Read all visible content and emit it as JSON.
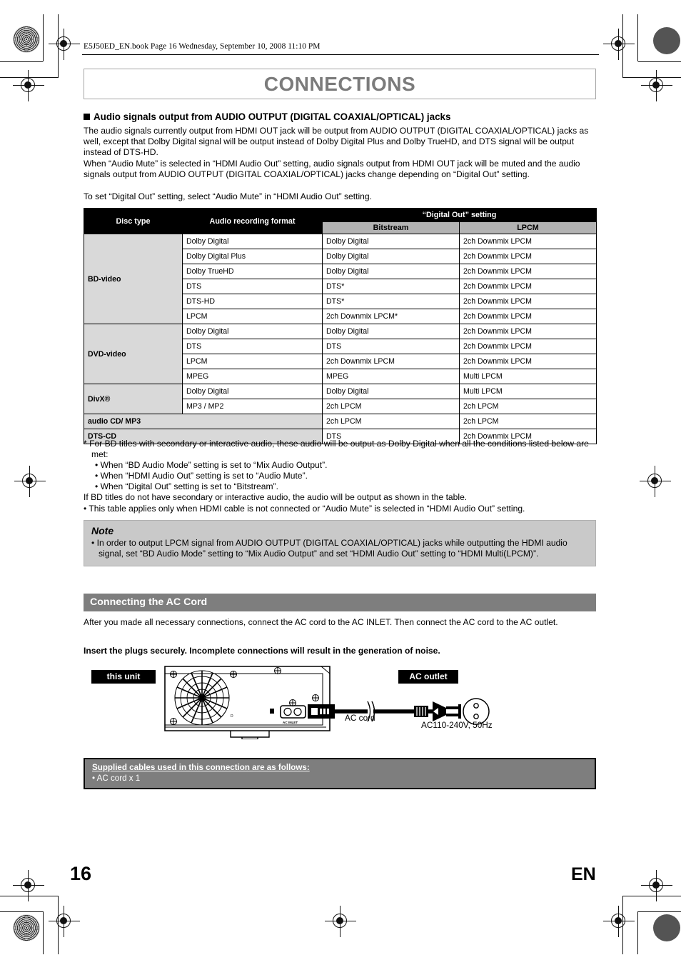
{
  "header": {
    "file_line": "E5J50ED_EN.book  Page 16  Wednesday, September 10, 2008  11:10 PM",
    "chapter_title": "CONNECTIONS"
  },
  "section": {
    "heading": "Audio signals output from AUDIO OUTPUT (DIGITAL COAXIAL/OPTICAL) jacks",
    "paragraph_1": "The audio signals currently output from HDMI OUT jack will be output from AUDIO OUTPUT (DIGITAL COAXIAL/OPTICAL) jacks as well, except that Dolby Digital signal will be output instead of Dolby Digital Plus and Dolby TrueHD, and DTS signal will be output instead of DTS-HD.",
    "paragraph_2": "When “Audio Mute” is selected in “HDMI Audio Out” setting, audio signals output from HDMI OUT jack will be muted and the audio signals output from AUDIO OUTPUT (DIGITAL COAXIAL/OPTICAL) jacks change depending on “Digital Out” setting.",
    "paragraph_3": "To set “Digital Out” setting, select “Audio Mute” in “HDMI Audio Out” setting."
  },
  "table": {
    "headers": {
      "disc_type": "Disc type",
      "audio_recording_format": "Audio recording format",
      "digital_out_setting": "“Digital Out” setting",
      "bitstream": "Bitstream",
      "lpcm": "LPCM"
    },
    "rows": [
      {
        "disc": "BD-video",
        "rowspan": 6,
        "format": "Dolby Digital",
        "bitstream": "Dolby Digital",
        "lpcm": "2ch Downmix LPCM"
      },
      {
        "format": "Dolby Digital Plus",
        "bitstream": "Dolby Digital",
        "lpcm": "2ch Downmix LPCM"
      },
      {
        "format": "Dolby TrueHD",
        "bitstream": "Dolby Digital",
        "lpcm": "2ch Downmix LPCM"
      },
      {
        "format": "DTS",
        "bitstream": "DTS*",
        "lpcm": "2ch Downmix LPCM"
      },
      {
        "format": "DTS-HD",
        "bitstream": "DTS*",
        "lpcm": "2ch Downmix LPCM"
      },
      {
        "format": "LPCM",
        "bitstream": "2ch Downmix LPCM*",
        "lpcm": "2ch Downmix LPCM"
      },
      {
        "disc": "DVD-video",
        "rowspan": 4,
        "format": "Dolby Digital",
        "bitstream": "Dolby Digital",
        "lpcm": "2ch Downmix LPCM"
      },
      {
        "format": "DTS",
        "bitstream": "DTS",
        "lpcm": "2ch Downmix LPCM"
      },
      {
        "format": "LPCM",
        "bitstream": "2ch Downmix LPCM",
        "lpcm": "2ch Downmix LPCM"
      },
      {
        "format": "MPEG",
        "bitstream": "MPEG",
        "lpcm": "Multi LPCM"
      },
      {
        "disc": "DivX®",
        "rowspan": 2,
        "format": "Dolby Digital",
        "bitstream": "Dolby Digital",
        "lpcm": "Multi LPCM"
      },
      {
        "format": "MP3 / MP2",
        "bitstream": "2ch LPCM",
        "lpcm": "2ch LPCM"
      },
      {
        "disc_wide": "audio CD/ MP3",
        "bitstream": "2ch LPCM",
        "lpcm": "2ch LPCM"
      },
      {
        "disc_wide": "DTS-CD",
        "bitstream": "DTS",
        "lpcm": "2ch Downmix LPCM"
      }
    ]
  },
  "footnotes": {
    "asterisk": "* For BD titles with secondary or interactive audio, these audio will be output as Dolby Digital when all the conditions listed below are met:",
    "bullets": [
      "• When “BD Audio Mode” setting is set to “Mix Audio Output”.",
      "• When “HDMI Audio Out” setting is set to “Audio Mute”.",
      "• When “Digital Out” setting is set to “Bitstream”."
    ],
    "line_after": "If BD titles do not have secondary or interactive audio, the audio will be output as shown in the table.",
    "last_bullet": "•  This table applies only when HDMI cable is not connected or “Audio Mute” is selected in “HDMI Audio Out” setting."
  },
  "note": {
    "title": "Note",
    "item": "• In order to output LPCM signal from AUDIO OUTPUT (DIGITAL COAXIAL/OPTICAL) jacks while outputting the HDMI audio signal, set “BD Audio Mode” setting to “Mix Audio Output” and set “HDMI Audio Out” setting to “HDMI Multi(LPCM)”."
  },
  "ac_cord_section": {
    "bar_title": "Connecting the AC Cord",
    "paragraph": "After you made all necessary connections, connect the AC cord to the AC INLET. Then connect the AC cord to the AC outlet.",
    "bold_line": "Insert the plugs securely. Incomplete connections will result in the generation of noise."
  },
  "diagram": {
    "tag_unit": "this unit",
    "tag_outlet": "AC outlet",
    "label_cord": "AC cord",
    "label_voltage": "AC110-240V, 50Hz",
    "inlet_label": "AC INLET"
  },
  "supplied_box": {
    "title": "Supplied cables used in this connection are as follows:",
    "item": "• AC cord x 1"
  },
  "footer": {
    "page_number": "16",
    "language": "EN"
  },
  "colors": {
    "title_gray": "#7b7b7b",
    "bar_gray": "#7e7e7e",
    "note_gray": "#c9c9c9",
    "table_header_black": "#000000",
    "table_subheader_gray": "#b3b3b3",
    "disc_cell_gray": "#d9d9d9"
  }
}
